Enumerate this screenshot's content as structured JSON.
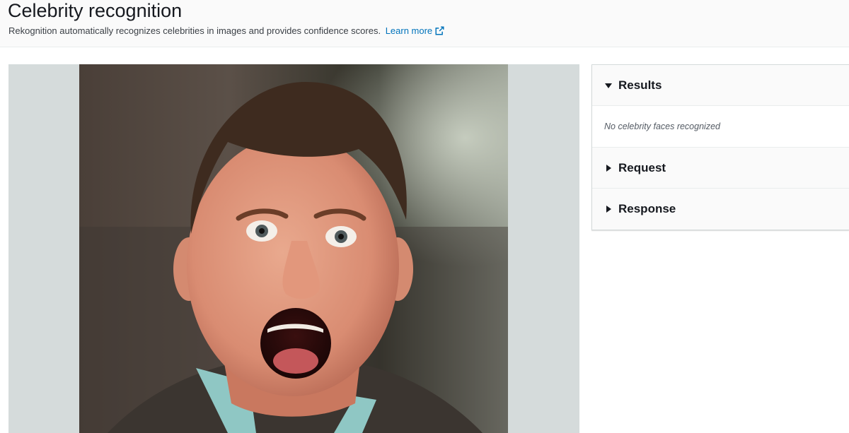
{
  "header": {
    "title": "Celebrity recognition",
    "description": "Rekognition automatically recognizes celebrities in images and provides confidence scores.",
    "learn_more": "Learn more",
    "link_color": "#0073bb"
  },
  "results_panel": {
    "sections": [
      {
        "label": "Results",
        "expanded": true,
        "icon": "caret-down-icon"
      },
      {
        "label": "Request",
        "expanded": false,
        "icon": "caret-right-icon"
      },
      {
        "label": "Response",
        "expanded": false,
        "icon": "caret-right-icon"
      }
    ],
    "results_message": "No celebrity faces recognized"
  }
}
